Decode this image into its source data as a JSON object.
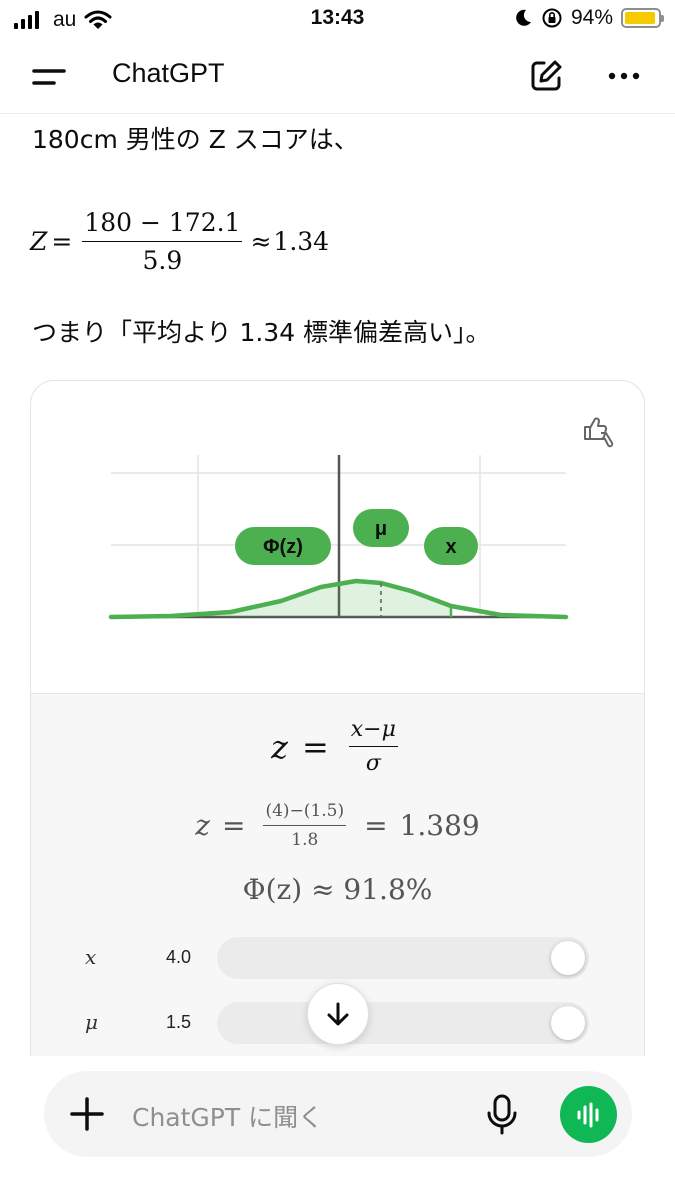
{
  "status_bar": {
    "carrier": "au",
    "time": "13:43",
    "battery_percent": "94%",
    "battery_level": 0.94
  },
  "header": {
    "title": "ChatGPT"
  },
  "message": {
    "z_intro": "180cm 男性の Z スコアは、",
    "formula": {
      "lhs": "Z",
      "eq": "=",
      "numerator": "180 − 172.1",
      "denominator": "5.9",
      "approx": "≈",
      "result": "1.34"
    },
    "summary": "つまり「平均より 1.34 標準偏差高い」。"
  },
  "widget": {
    "chart_labels": {
      "phi": "Φ(z)",
      "mu": "μ",
      "x": "x"
    },
    "formula_general": {
      "lhs": "z",
      "eq": "=",
      "numerator": "x−μ",
      "denominator": "σ"
    },
    "formula_numeric": {
      "lhs": "z",
      "eq": "=",
      "numerator": "(4)−(1.5)",
      "denominator": "1.8",
      "eq2": "=",
      "result": "1.389"
    },
    "phi_result": "Φ(z) ≈ 91.8%",
    "sliders": [
      {
        "var": "x",
        "value": "4.0",
        "position": 1.0
      },
      {
        "var": "μ",
        "value": "1.5",
        "position": 1.0
      }
    ]
  },
  "composer": {
    "placeholder": "ChatGPT に聞く"
  },
  "colors": {
    "accent_green": "#0fb855",
    "chart_green": "#4caf50",
    "battery_yellow": "#f8c800"
  }
}
